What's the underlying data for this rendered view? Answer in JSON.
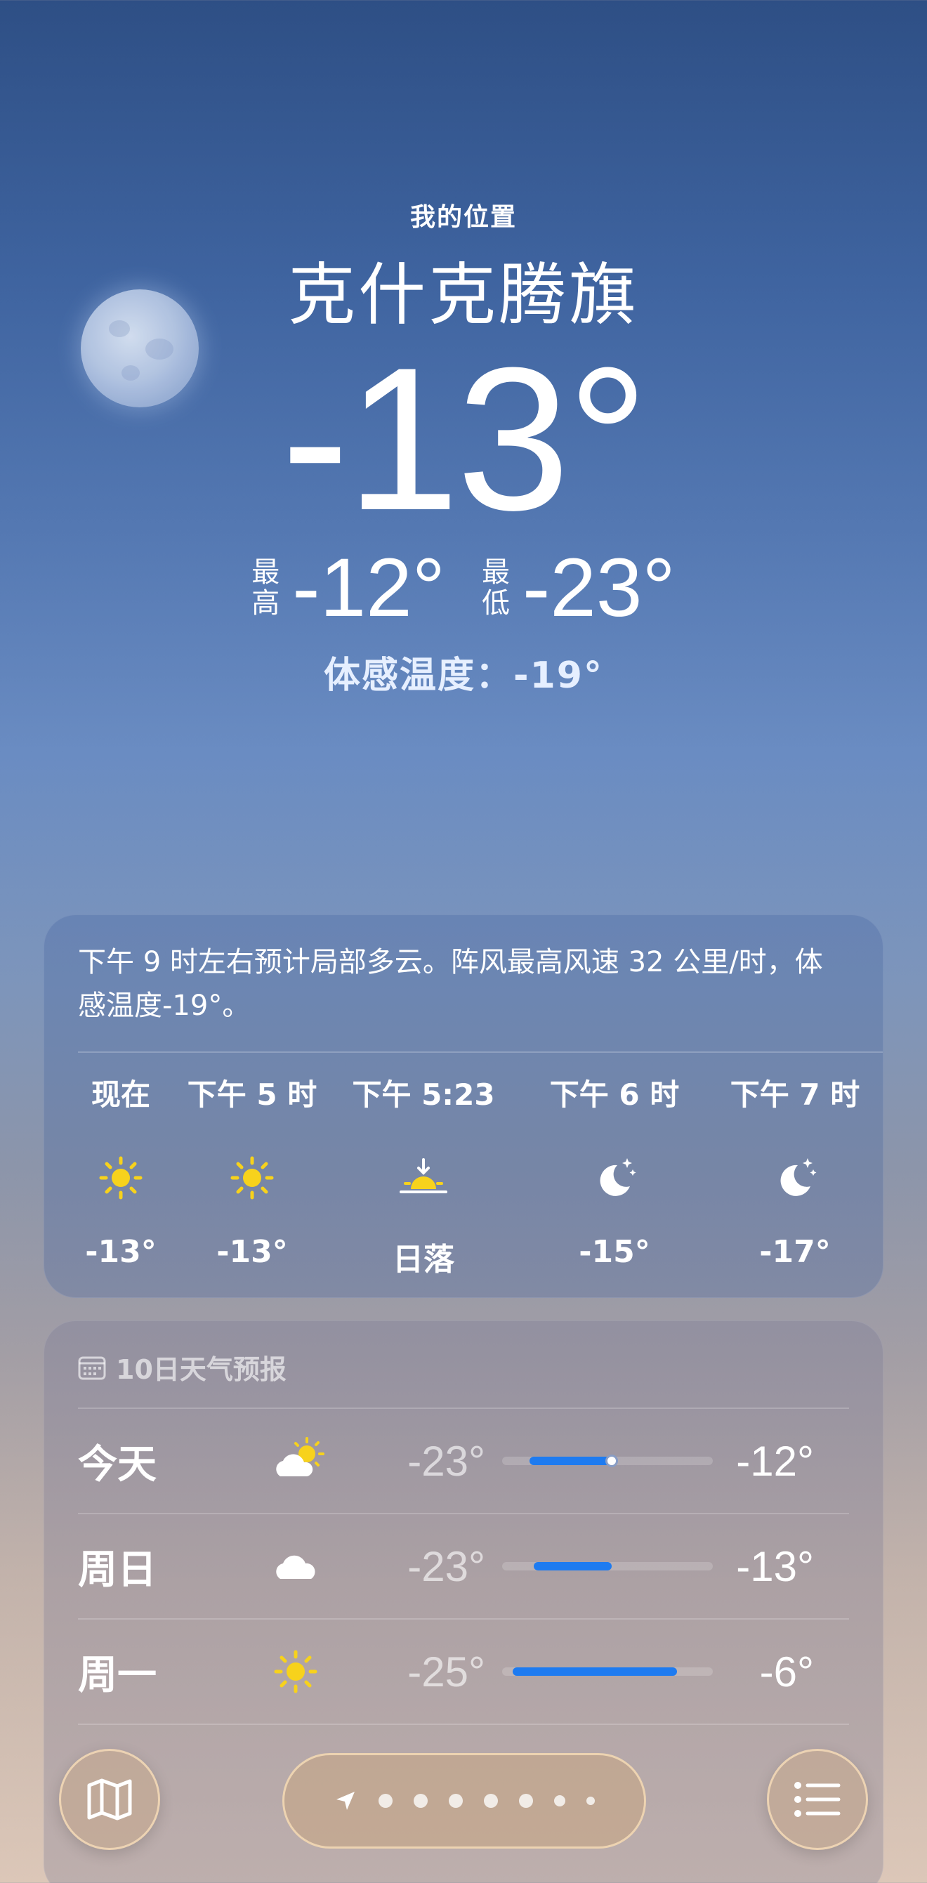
{
  "header": {
    "location_label": "我的位置",
    "city": "克什克腾旗",
    "current_temp": "-13°",
    "high_label_top": "最",
    "high_label_bottom": "高",
    "high_temp": "-12°",
    "low_label_top": "最",
    "low_label_bottom": "低",
    "low_temp": "-23°",
    "feels_like": "体感温度：-19°"
  },
  "hourly": {
    "summary": "下午 9 时左右预计局部多云。阵风最高风速 32 公里/时，体感温度-19°。",
    "items": [
      {
        "time": "现在",
        "icon": "sun-icon",
        "temp": "-13°"
      },
      {
        "time": "下午 5 时",
        "icon": "sun-icon",
        "temp": "-13°"
      },
      {
        "time": "下午 5:23",
        "icon": "sunset-icon",
        "temp": "日落"
      },
      {
        "time": "下午 6 时",
        "icon": "moon-stars-icon",
        "temp": "-15°"
      },
      {
        "time": "下午 7 时",
        "icon": "moon-stars-icon",
        "temp": "-17°"
      }
    ]
  },
  "daily": {
    "title": "10日天气预报",
    "days": [
      {
        "name": "今天",
        "icon": "partly-cloudy-icon",
        "low": "-23°",
        "high": "-12°",
        "range_start": 0.13,
        "range_end": 0.55,
        "current_marker": 0.52
      },
      {
        "name": "周日",
        "icon": "cloud-icon",
        "low": "-23°",
        "high": "-13°",
        "range_start": 0.15,
        "range_end": 0.52
      },
      {
        "name": "周一",
        "icon": "sun-icon",
        "low": "-25°",
        "high": "-6°",
        "range_start": 0.05,
        "range_end": 0.83
      }
    ]
  },
  "colors": {
    "bar_fill": "#1e7bf0",
    "sun": "#f7d21c"
  }
}
